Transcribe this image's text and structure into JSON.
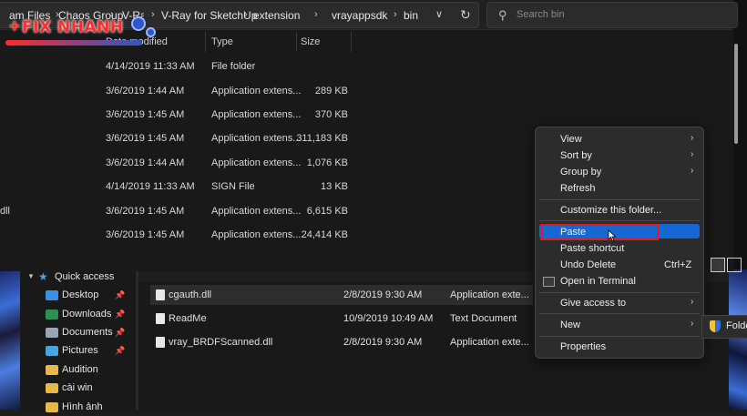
{
  "address_bar": {
    "crumbs": [
      "am Files",
      "Chaos Group",
      "V-Ray",
      "V-Ray for SketchUp",
      "extension",
      "vrayappsdk",
      "bin"
    ],
    "separator": "›"
  },
  "search": {
    "placeholder": "Search bin"
  },
  "columns": {
    "date_modified": "Date modified",
    "type": "Type",
    "size": "Size"
  },
  "front_rows": [
    {
      "name": "",
      "date": "4/14/2019 11:33 AM",
      "type": "File folder",
      "size": ""
    },
    {
      "name": "",
      "date": "3/6/2019 1:44 AM",
      "type": "Application extens...",
      "size": "289 KB"
    },
    {
      "name": "",
      "date": "3/6/2019 1:45 AM",
      "type": "Application extens...",
      "size": "370 KB"
    },
    {
      "name": "",
      "date": "3/6/2019 1:45 AM",
      "type": "Application extens...",
      "size": "311,183 KB"
    },
    {
      "name": "",
      "date": "3/6/2019 1:44 AM",
      "type": "Application extens...",
      "size": "1,076 KB"
    },
    {
      "name": "",
      "date": "4/14/2019 11:33 AM",
      "type": "SIGN File",
      "size": "13 KB"
    },
    {
      "name": "dll",
      "date": "3/6/2019 1:45 AM",
      "type": "Application extens...",
      "size": "6,615 KB"
    },
    {
      "name": "",
      "date": "3/6/2019 1:45 AM",
      "type": "Application extens...",
      "size": "24,414 KB"
    }
  ],
  "nav": {
    "quick_access": "Quick access",
    "items": [
      {
        "label": "Desktop",
        "icon": "desktop-icon",
        "color": "#3d8ee8",
        "pinned": true
      },
      {
        "label": "Downloads",
        "icon": "downloads-icon",
        "color": "#2f8f4e",
        "pinned": true
      },
      {
        "label": "Documents",
        "icon": "documents-icon",
        "color": "#9aa6b5",
        "pinned": true
      },
      {
        "label": "Pictures",
        "icon": "pictures-icon",
        "color": "#4aa3e0",
        "pinned": true
      },
      {
        "label": "Audition",
        "icon": "folder-icon",
        "color": "#e8b84a",
        "pinned": false
      },
      {
        "label": "cài win",
        "icon": "folder-icon",
        "color": "#e8b84a",
        "pinned": false
      },
      {
        "label": "Hình ảnh",
        "icon": "folder-icon",
        "color": "#e8b84a",
        "pinned": false
      }
    ]
  },
  "back_rows": [
    {
      "name": "cgauth.dll",
      "date": "2/8/2019 9:30 AM",
      "type": "Application exte..."
    },
    {
      "name": "ReadMe",
      "date": "10/9/2019 10:49 AM",
      "type": "Text Document"
    },
    {
      "name": "vray_BRDFScanned.dll",
      "date": "2/8/2019 9:30 AM",
      "type": "Application exte..."
    }
  ],
  "context_menu": {
    "view": "View",
    "sort_by": "Sort by",
    "group_by": "Group by",
    "refresh": "Refresh",
    "customize": "Customize this folder...",
    "paste": "Paste",
    "paste_shortcut": "Paste shortcut",
    "undo_delete": "Undo Delete",
    "undo_shortcut": "Ctrl+Z",
    "open_terminal": "Open in Terminal",
    "give_access": "Give access to",
    "new": "New",
    "properties": "Properties"
  },
  "submenu": {
    "folder": "Folder"
  },
  "watermark": {
    "text": "FIX NHANH"
  },
  "colors": {
    "highlight": "#1568d4",
    "annotation": "#e01b1b"
  }
}
